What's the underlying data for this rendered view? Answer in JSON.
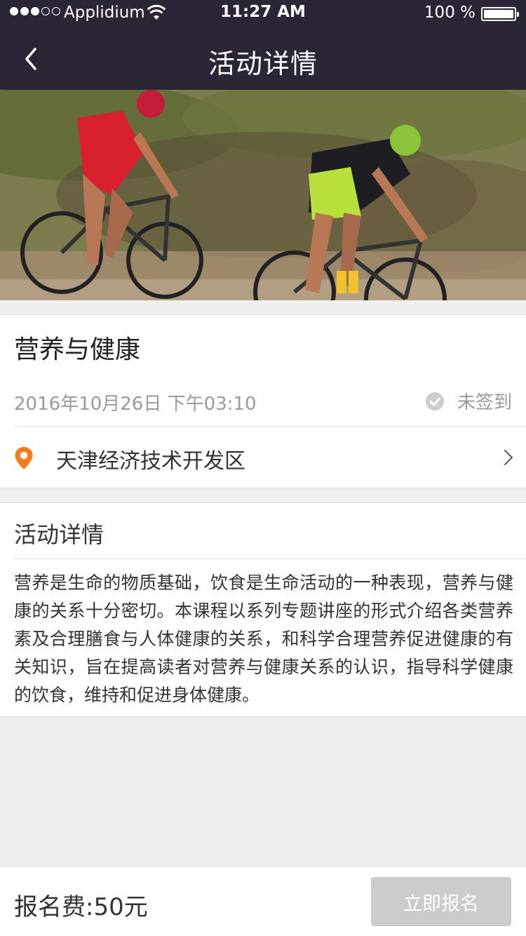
{
  "status_bar": {
    "carrier": "Applidium",
    "time": "11:27 AM",
    "battery": "100 %"
  },
  "nav": {
    "title": "活动详情",
    "back_icon": "chevron-left-icon"
  },
  "hero": {
    "image": "mountain-bike-racers-photo"
  },
  "event": {
    "title": "营养与健康",
    "datetime": "2016年10月26日 下午03:10",
    "checkin_status": "未签到",
    "checkin_icon": "check-circle-icon",
    "location": "天津经济技术开发区",
    "location_icon": "map-pin-icon"
  },
  "details": {
    "section_title": "活动详情",
    "description": "营养是生命的物质基础，饮食是生命活动的一种表现，营养与健康的关系十分密切。本课程以系列专题讲座的形式介绍各类营养素及合理膳食与人体健康的关系，和科学合理营养促进健康的有关知识，旨在提高读者对营养与健康关系的认识，指导科学健康的饮食，维持和促进身体健康。"
  },
  "footer": {
    "fee_label": "报名费:50元",
    "signup_button": "立即报名"
  },
  "colors": {
    "nav_bg": "#2c2536",
    "page_bg": "#efefef",
    "pin": "#f57c1f",
    "button_disabled": "#cccccc",
    "muted_text": "#9a9a9a"
  }
}
